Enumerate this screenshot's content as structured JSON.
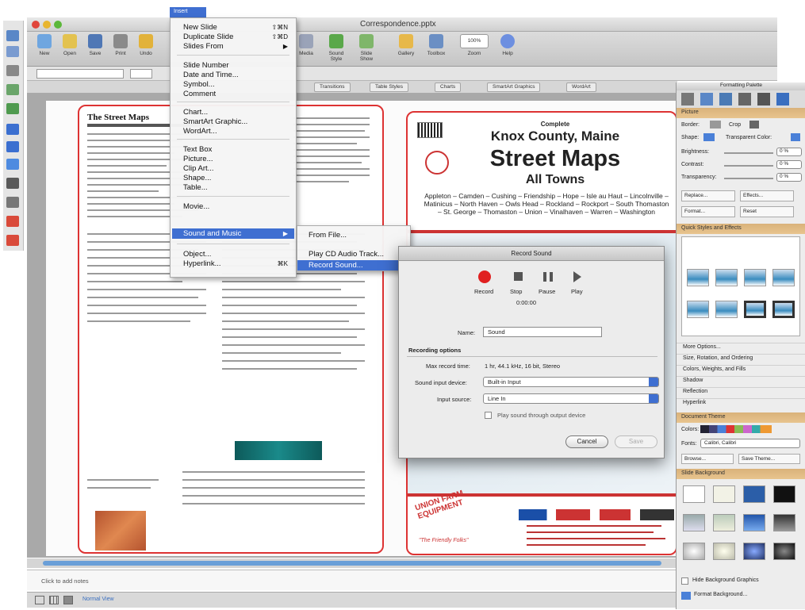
{
  "window": {
    "title": "Correspondence.pptx"
  },
  "menubar": {
    "active_menu": "Insert"
  },
  "toolbar": {
    "buttons": [
      "New",
      "Open",
      "Save",
      "Print",
      "Undo"
    ],
    "right_buttons": [
      "Media",
      "Sound Style",
      "Slide Show",
      "Gallery",
      "Toolbox",
      "Zoom",
      "Help"
    ],
    "zoom_value": "100%"
  },
  "ribbon": {
    "tabs": [
      "Transitions",
      "Table Styles",
      "Charts",
      "SmartArt Graphics",
      "WordArt"
    ]
  },
  "insert_menu": {
    "items": [
      {
        "label": "New Slide",
        "shortcut": "⇧⌘N"
      },
      {
        "label": "Duplicate Slide",
        "shortcut": "⇧⌘D"
      },
      {
        "label": "Slides From",
        "shortcut": "▶"
      },
      {
        "label": "Slide Number",
        "shortcut": ""
      },
      {
        "label": "Date and Time...",
        "shortcut": ""
      },
      {
        "label": "Symbol...",
        "shortcut": ""
      },
      {
        "label": "Comment",
        "shortcut": ""
      },
      {
        "label": "Chart...",
        "shortcut": ""
      },
      {
        "label": "SmartArt Graphic...",
        "shortcut": ""
      },
      {
        "label": "WordArt...",
        "shortcut": ""
      },
      {
        "label": "Text Box",
        "shortcut": ""
      },
      {
        "label": "Picture...",
        "shortcut": ""
      },
      {
        "label": "Clip Art...",
        "shortcut": ""
      },
      {
        "label": "Shape...",
        "shortcut": ""
      },
      {
        "label": "Table...",
        "shortcut": ""
      },
      {
        "label": "Movie...",
        "shortcut": ""
      },
      {
        "label": "Sound and Music",
        "shortcut": "▶"
      },
      {
        "label": "Object...",
        "shortcut": ""
      },
      {
        "label": "Hyperlink...",
        "shortcut": "⌘K"
      }
    ]
  },
  "submenu": {
    "items": [
      "From File...",
      "Play CD Audio Track...",
      "Record Sound..."
    ]
  },
  "record_dialog": {
    "title": "Record Sound",
    "controls": [
      "Record",
      "Stop",
      "Pause",
      "Play"
    ],
    "time": "0:00:00",
    "name_label": "Name:",
    "name_value": "Sound",
    "section_label": "Recording options",
    "max_time_label": "Max record time:",
    "max_time_value": "1 hr, 44.1 kHz, 16 bit, Stereo",
    "device_label": "Sound input device:",
    "device_value": "Built-in Input",
    "source_label": "Input source:",
    "source_value": "Line In",
    "checkbox_label": "Play sound through output device",
    "cancel_label": "Cancel",
    "save_label": "Save"
  },
  "slide_right": {
    "badge": "Complete",
    "title1": "Knox County, Maine",
    "title2": "Street Maps",
    "title3": "All Towns",
    "towns": "Appleton – Camden – Cushing – Friendship – Hope – Isle au Haut – Lincolnville – Matinicus – North Haven – Owls Head – Rockland – Rockport – South Thomaston – St. George – Thomaston – Union – Vinalhaven – Warren – Washington",
    "ad_name": "UNION FARM EQUIPMENT",
    "ad_tagline": "\"The Friendly Folks\""
  },
  "slide_left": {
    "heading": "The Street Maps"
  },
  "formatting_palette": {
    "title": "Formatting Palette",
    "sections": [
      "Picture",
      "Quick Styles and Effects",
      "Document Theme",
      "Slide Background"
    ],
    "picture_rows": [
      "Border:",
      "Crop",
      "Shape:",
      "Transparent Color:",
      "Brightness:",
      "Contrast:",
      "Transparency:"
    ],
    "picture_values": [
      "0 %",
      "0 %",
      "0 %"
    ],
    "buttons": [
      "Replace...",
      "Effects...",
      "Format...",
      "Reset"
    ],
    "more_options": "More Options...",
    "collapsed": [
      "Size, Rotation, and Ordering",
      "Colors, Weights, and Fills",
      "Shadow",
      "Reflection",
      "Hyperlink"
    ],
    "colors_label": "Colors:",
    "fonts_label": "Fonts:",
    "fonts_value": "Calibri, Calibri",
    "browse_label": "Browse...",
    "save_theme_label": "Save Theme...",
    "hide_bg_label": "Hide Background Graphics",
    "format_bg_label": "Format Background..."
  },
  "notes": {
    "placeholder": "Click to add notes"
  },
  "status": {
    "view": "Normal View"
  }
}
